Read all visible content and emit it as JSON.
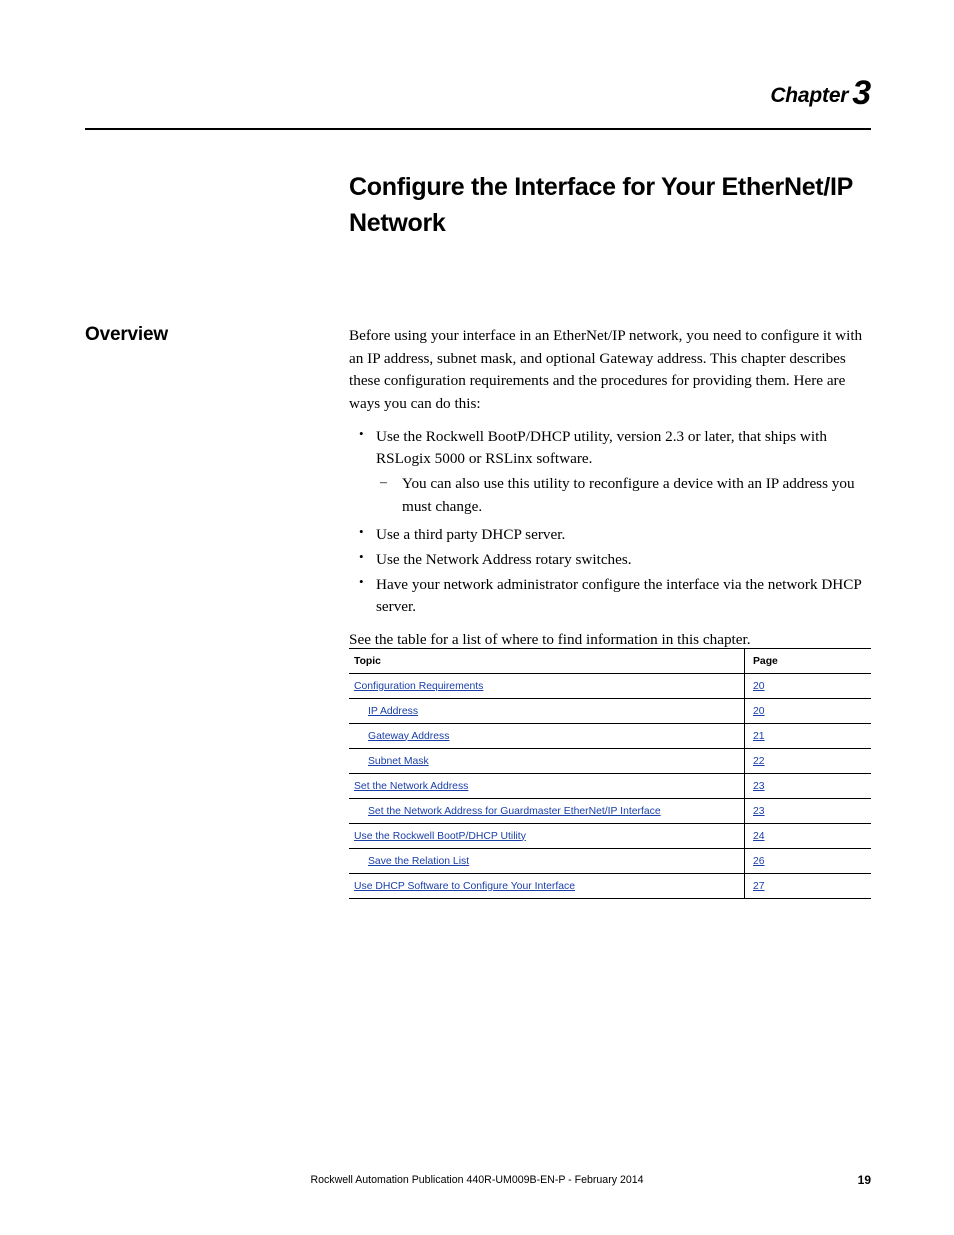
{
  "chapter": {
    "label": "Chapter",
    "number": "3"
  },
  "title": "Configure the Interface for Your EtherNet/IP Network",
  "section": {
    "heading": "Overview",
    "intro": "Before using your interface in an EtherNet/IP network, you need to configure it with an IP address, subnet mask, and optional Gateway address. This chapter describes these configuration requirements and the procedures for providing them. Here are ways you can do this:",
    "bullets": [
      "Use the Rockwell BootP/DHCP utility, version 2.3 or later, that ships with RSLogix 5000 or RSLinx software.",
      "Use a third party DHCP server.",
      "Use the Network Address rotary switches.",
      "Have your network administrator configure the interface via the network DHCP server."
    ],
    "subbullet": "You can also use this utility to reconfigure a device with an IP address you must change.",
    "see_table": "See the table for a list of where to find information in this chapter."
  },
  "toc": {
    "headers": {
      "topic": "Topic",
      "page": "Page"
    },
    "rows": [
      {
        "topic": "Configuration Requirements",
        "page": "20",
        "indent": 0
      },
      {
        "topic": "IP Address",
        "page": "20",
        "indent": 1
      },
      {
        "topic": "Gateway Address",
        "page": "21",
        "indent": 1
      },
      {
        "topic": "Subnet Mask",
        "page": "22",
        "indent": 1
      },
      {
        "topic": "Set the Network Address",
        "page": "23",
        "indent": 0
      },
      {
        "topic": "Set the Network Address for Guardmaster EtherNet/IP Interface",
        "page": "23",
        "indent": 1
      },
      {
        "topic": "Use the Rockwell BootP/DHCP Utility",
        "page": "24",
        "indent": 0
      },
      {
        "topic": "Save the Relation List",
        "page": "26",
        "indent": 1
      },
      {
        "topic": "Use DHCP Software to Configure Your Interface",
        "page": "27",
        "indent": 0
      }
    ]
  },
  "footer": {
    "text": "Rockwell Automation Publication 440R-UM009B-EN-P - February 2014",
    "page_number": "19"
  },
  "colors": {
    "link": "#1b3fa8",
    "text": "#000000"
  }
}
